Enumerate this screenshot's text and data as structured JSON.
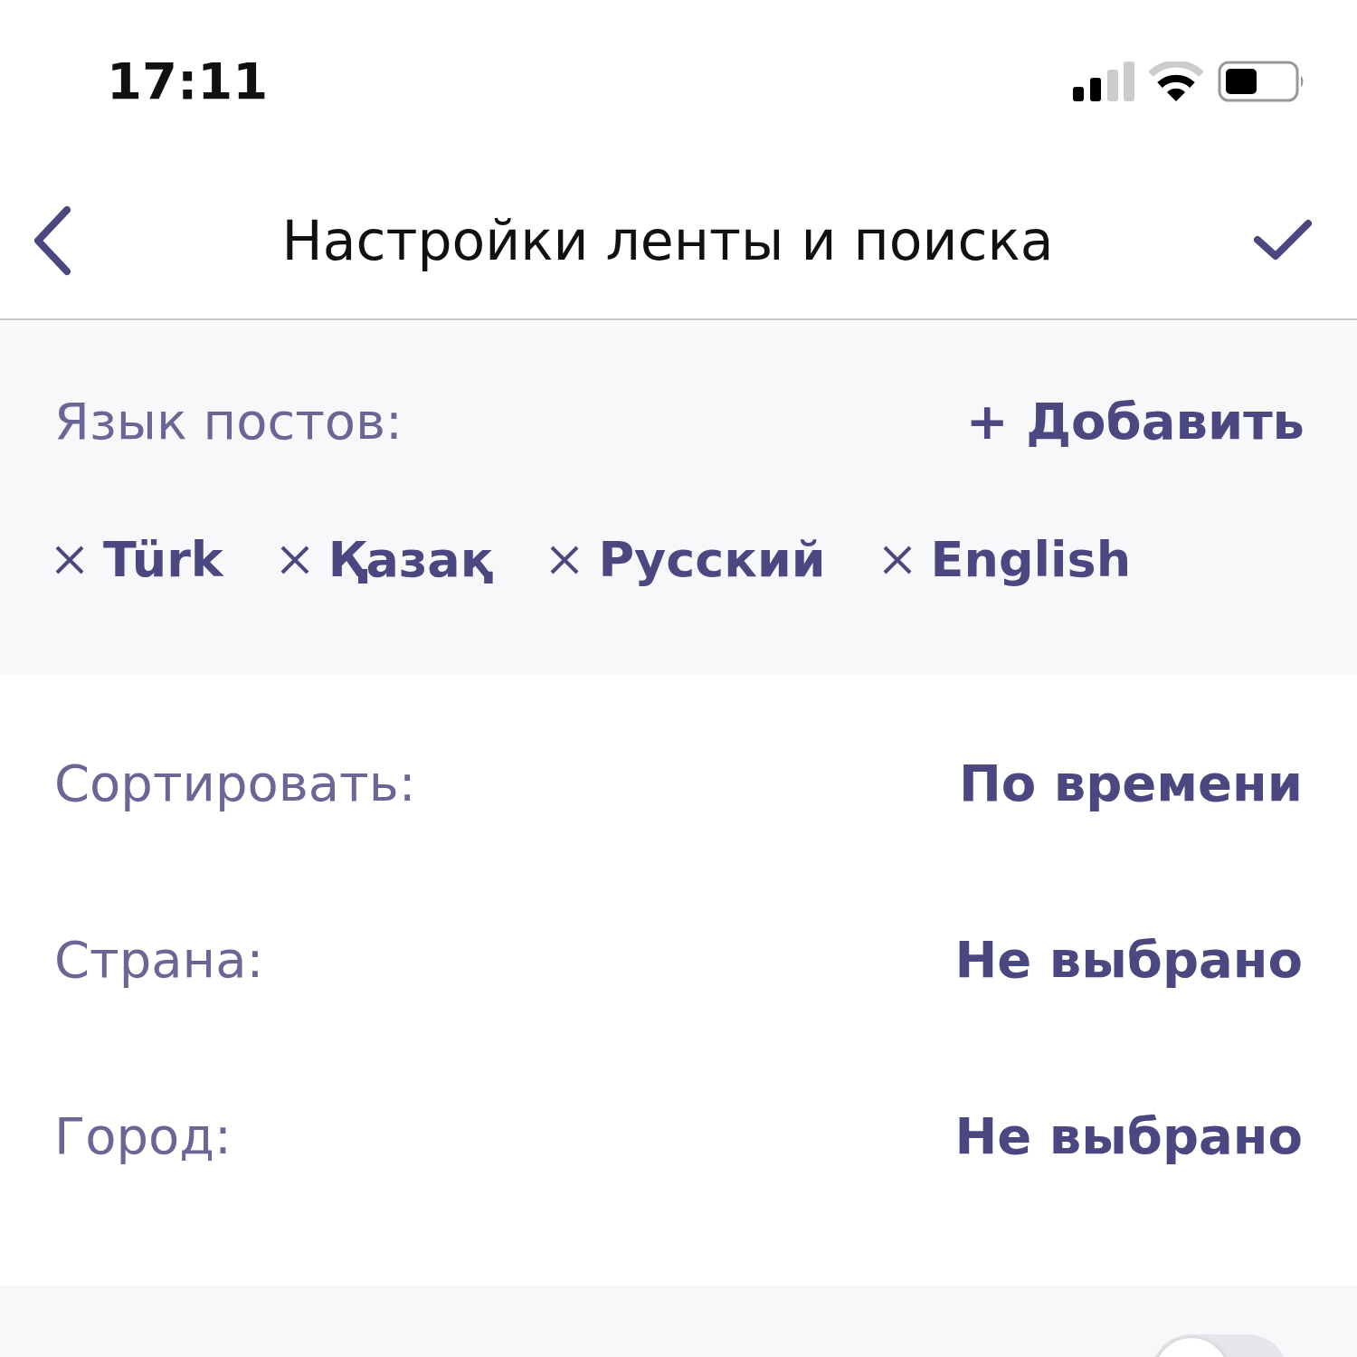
{
  "status_bar": {
    "time": "17:11"
  },
  "header": {
    "title": "Настройки ленты и поиска"
  },
  "languages": {
    "label": "Язык постов:",
    "add": "+ Добавить",
    "items": [
      {
        "label": "Türk"
      },
      {
        "label": "Қазақ"
      },
      {
        "label": "Русский"
      },
      {
        "label": "English"
      }
    ]
  },
  "settings": [
    {
      "label": "Сортировать:",
      "value": "По времени"
    },
    {
      "label": "Страна:",
      "value": "Не выбрано"
    },
    {
      "label": "Город:",
      "value": "Не выбрано"
    }
  ],
  "nearby": {
    "on": false
  }
}
